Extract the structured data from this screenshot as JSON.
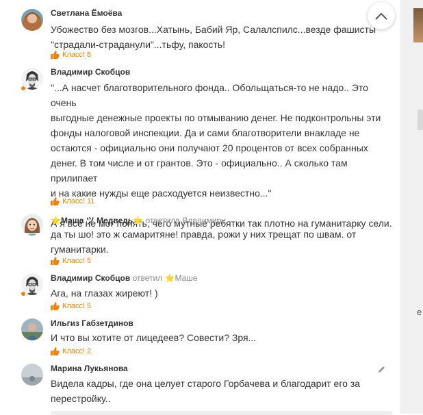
{
  "comments": [
    {
      "author": "Светлана Ёмоёва",
      "reply_label": "",
      "reply_to": "",
      "lines": [
        "Убожество без мозгов...Хатынь, Бабий Яр, Салалспилс...везде фашисты",
        "\"страдали-страданули\"...тьфу, пакость!"
      ],
      "like_label": "Класс!",
      "like_count": "8"
    },
    {
      "author": "Владимир Скобцов",
      "reply_label": "",
      "reply_to": "",
      "lines": [
        "\"...А насчет благотворительного фонда.. Обольщаться-то не надо.. Это очень",
        "выгодные денежные проекты по отмыванию денег. Не подконтрольны эти",
        "фонды налоговой инспекции. Да и сами благотворители внакладе не",
        "остаются - официально они получают 20 процентов от всех собранных",
        "денег. В том числе и от грантов. Это - официально.. А сколько там прилипает",
        "и на какие нужды еще расходуется неизвестно...\"",
        "",
        "А я всё не мог понять, чего мутные ребятки так плотно на гуманитарку сели."
      ],
      "like_label": "Класс!",
      "like_count": "11"
    },
    {
      "author": "⭐Маша ツ Медведь⭐",
      "reply_label": "ответила",
      "reply_to": "Владимиру",
      "lines": [
        "да ты шо! это ж самаритяне! правда, рожи у них трещат по швам. от",
        "гуманитарки."
      ],
      "like_label": "Класс!",
      "like_count": "5"
    },
    {
      "author": "Владимир Скобцов",
      "reply_label": "ответил",
      "reply_to": "⭐Маше",
      "lines": [
        "Ага, на глазах жиреют! )"
      ],
      "like_label": "Класс!",
      "like_count": "5"
    },
    {
      "author": "Ильгиз Габзетдинов",
      "reply_label": "",
      "reply_to": "",
      "lines": [
        "И что вы хотите от лицедеев? Совести? Зря..."
      ],
      "like_label": "Класс!",
      "like_count": "2"
    },
    {
      "author": "Марина Лукьянова",
      "reply_label": "",
      "reply_to": "",
      "lines": [
        "Видела кадры, где она целует старого Горбачева и благодарит его за",
        "перестройку.."
      ],
      "like_label": "",
      "like_count": ""
    }
  ],
  "colors": {
    "accent": "#ee8208",
    "author": "#333333",
    "muted": "#888888",
    "text": "#333333",
    "gutter": "#f0f0f0"
  },
  "icons": {
    "scroll_up": "chevron-up-icon",
    "like": "thumb-up-icon",
    "edit": "pencil-icon"
  }
}
